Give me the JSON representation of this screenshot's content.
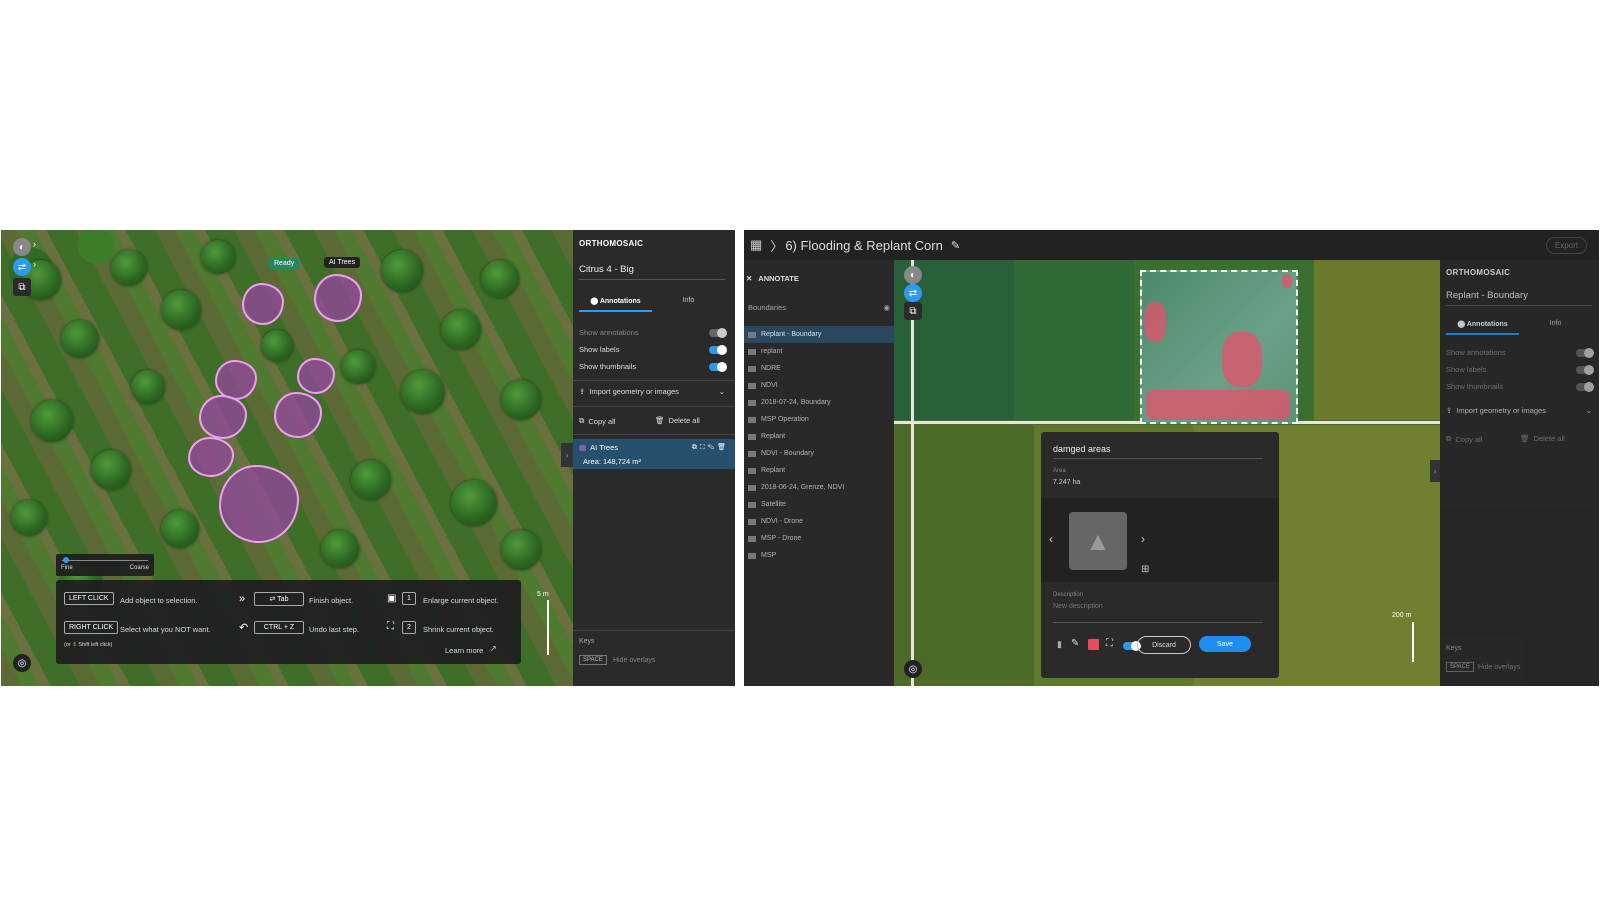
{
  "left": {
    "map_labels": {
      "ready": "Ready",
      "ai_trees": "AI Trees"
    },
    "scale": "5 m",
    "slider": {
      "fine": "Fine",
      "coarse": "Coarse",
      "value": 0.05
    },
    "help": {
      "left_click_key": "LEFT CLICK",
      "left_click_text": "Add object to selection.",
      "right_click_key": "RIGHT CLICK",
      "right_click_text": "Select what you NOT want.",
      "right_click_hint": "(or ⇧ Shift left click)",
      "tab_key": "⇄ Tab",
      "tab_text": "Finish object.",
      "undo_key": "CTRL + Z",
      "undo_text": "Undo last step.",
      "enlarge_key": "1",
      "enlarge_text": "Enlarge current object.",
      "shrink_key": "2",
      "shrink_text": "Shrink current object.",
      "learn_more": "Learn more"
    },
    "panel": {
      "title": "ORTHOMOSAIC",
      "name": "Citrus 4 - Big",
      "tabs": [
        "Annotations",
        "Info"
      ],
      "toggles": [
        {
          "label": "Show annotations",
          "on": false
        },
        {
          "label": "Show labels",
          "on": true
        },
        {
          "label": "Show thumbnails",
          "on": true
        }
      ],
      "import": "Import geometry or images",
      "copy_all": "Copy all",
      "delete_all": "Delete all",
      "annotation": {
        "name": "AI Trees",
        "area": "Area: 148,724 m²"
      },
      "keys_label": "Keys",
      "space_key": "SPACE",
      "space_text": "Hide overlays"
    }
  },
  "right": {
    "breadcrumb": "6) Flooding & Replant Corn",
    "export": "Export",
    "annotate_title": "ANNOTATE",
    "boundaries": "Boundaries",
    "layers": [
      {
        "name": "Replant - Boundary",
        "active": true
      },
      {
        "name": "replant",
        "active": false
      },
      {
        "name": "NDRE",
        "active": false
      },
      {
        "name": "NDVI",
        "active": false
      },
      {
        "name": "2018-07-24, Boundary",
        "active": false
      },
      {
        "name": "MSP Operation",
        "active": false
      },
      {
        "name": "Replant",
        "active": false
      },
      {
        "name": "NDVI - Boundary",
        "active": false
      },
      {
        "name": "Replant",
        "active": false
      },
      {
        "name": "2018-06-24, Grenze, NDVI",
        "active": false
      },
      {
        "name": "Satellite",
        "active": false
      },
      {
        "name": "NDVI - Drone",
        "active": false
      },
      {
        "name": "MSP - Drone",
        "active": false
      },
      {
        "name": "MSP",
        "active": false
      }
    ],
    "scale": "200 m",
    "dialog": {
      "title": "damged areas",
      "area_label": "Area",
      "area_value": "7.247 ha",
      "description_label": "Description",
      "description_placeholder": "New description",
      "discard": "Discard",
      "save": "Save",
      "accent": "#e84c5a"
    },
    "panel": {
      "title": "ORTHOMOSAIC",
      "name": "Replant - Boundary",
      "tabs": [
        "Annotations",
        "Info"
      ],
      "toggles": [
        {
          "label": "Show annotations",
          "on": true
        },
        {
          "label": "Show labels",
          "on": true
        },
        {
          "label": "Show thumbnails",
          "on": true
        }
      ],
      "import": "Import geometry or images",
      "copy_all": "Copy all",
      "delete_all": "Delete all",
      "keys_label": "Keys",
      "space_key": "SPACE",
      "space_text": "Hide overlays"
    }
  }
}
